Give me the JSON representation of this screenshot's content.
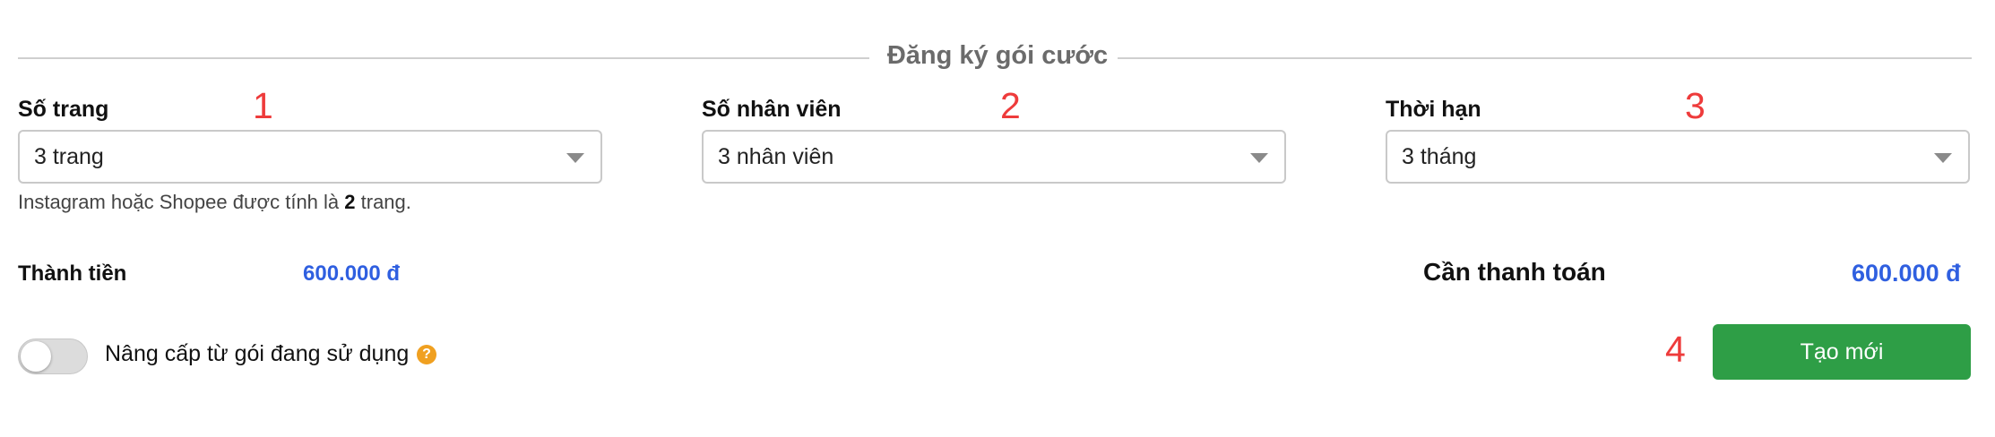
{
  "section": {
    "title": "Đăng ký gói cước"
  },
  "fields": [
    {
      "label": "Số trang",
      "marker": "1",
      "value": "3 trang"
    },
    {
      "label": "Số nhân viên",
      "marker": "2",
      "value": "3 nhân viên"
    },
    {
      "label": "Thời hạn",
      "marker": "3",
      "value": "3 tháng"
    }
  ],
  "hint": {
    "prefix": "Instagram hoặc Shopee được tính là ",
    "bold": "2",
    "suffix": " trang."
  },
  "subtotal": {
    "label": "Thành tiền",
    "value": "600.000 đ"
  },
  "payment": {
    "label": "Cần thanh toán",
    "value": "600.000 đ"
  },
  "upgrade": {
    "label": "Nâng cấp từ gói đang sử dụng",
    "toggle_on": false,
    "help_icon": "question-circle-icon"
  },
  "actions": {
    "marker": "4",
    "create_label": "Tạo mới"
  },
  "colors": {
    "accent_price": "#2f5fe0",
    "button_green": "#2e9e46",
    "marker_red": "#ee3b3b",
    "help_orange": "#f0a020"
  }
}
